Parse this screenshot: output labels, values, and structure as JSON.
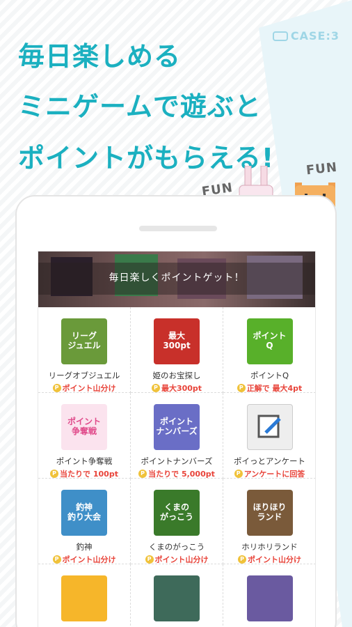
{
  "case_label": "CASE:3",
  "headline": {
    "line1": "毎日楽しめる",
    "line2": "ミニゲームで遊ぶと",
    "line3": "ポイントがもらえる!"
  },
  "fun_labels": [
    "FUN",
    "FUN"
  ],
  "colors": {
    "accent": "#1bb0c0",
    "reward": "#e8443a",
    "coin": "#f0c23a"
  },
  "banner_text": "毎日楽しくポイントゲット！",
  "games": [
    {
      "name": "リーグオブジュエル",
      "reward": "ポイント山分け",
      "icon": "league-of-jewel-icon",
      "icon_text": "リーグ\nジュエル",
      "bg": "#6a9a3a"
    },
    {
      "name": "姫のお宝探し",
      "reward": "最大300pt",
      "icon": "princess-treasure-icon",
      "icon_text": "最大\n300pt",
      "bg": "#c8302a"
    },
    {
      "name": "ポイントQ",
      "reward": "正解で 最大4pt",
      "icon": "point-q-icon",
      "icon_text": "ポイント\nQ",
      "bg": "#58b02a"
    },
    {
      "name": "ポイント争奪戦",
      "reward": "当たりで 100pt",
      "icon": "point-battle-icon",
      "icon_text": "ポイント\n争奪戦",
      "bg": "#fbe3ee"
    },
    {
      "name": "ポイントナンバーズ",
      "reward": "当たりで 5,000pt",
      "icon": "point-numbers-icon",
      "icon_text": "ポイント\nナンバーズ",
      "bg": "#6a6ec6"
    },
    {
      "name": "ポイっとアンケート",
      "reward": "アンケートに回答",
      "icon": "survey-icon",
      "icon_text": "",
      "bg": "#eeeeee"
    },
    {
      "name": "釣神",
      "reward": "ポイント山分け",
      "icon": "fishing-god-icon",
      "icon_text": "釣神\n釣り大会",
      "bg": "#3f8fc8"
    },
    {
      "name": "くまのがっこう",
      "reward": "ポイント山分け",
      "icon": "bear-school-icon",
      "icon_text": "くまの\nがっこう",
      "bg": "#3a7a2a"
    },
    {
      "name": "ホリホリランド",
      "reward": "ポイント山分け",
      "icon": "horihori-land-icon",
      "icon_text": "ほりほり\nランド",
      "bg": "#7a5a3a"
    },
    {
      "name": "",
      "reward": "",
      "icon": "bear-face-icon",
      "icon_text": "",
      "bg": "#f6b62a"
    },
    {
      "name": "",
      "reward": "",
      "icon": "soccer-icon",
      "icon_text": "",
      "bg": "#3e6a5a"
    },
    {
      "name": "",
      "reward": "",
      "icon": "anime-character-icon",
      "icon_text": "",
      "bg": "#6a5aa0"
    }
  ]
}
